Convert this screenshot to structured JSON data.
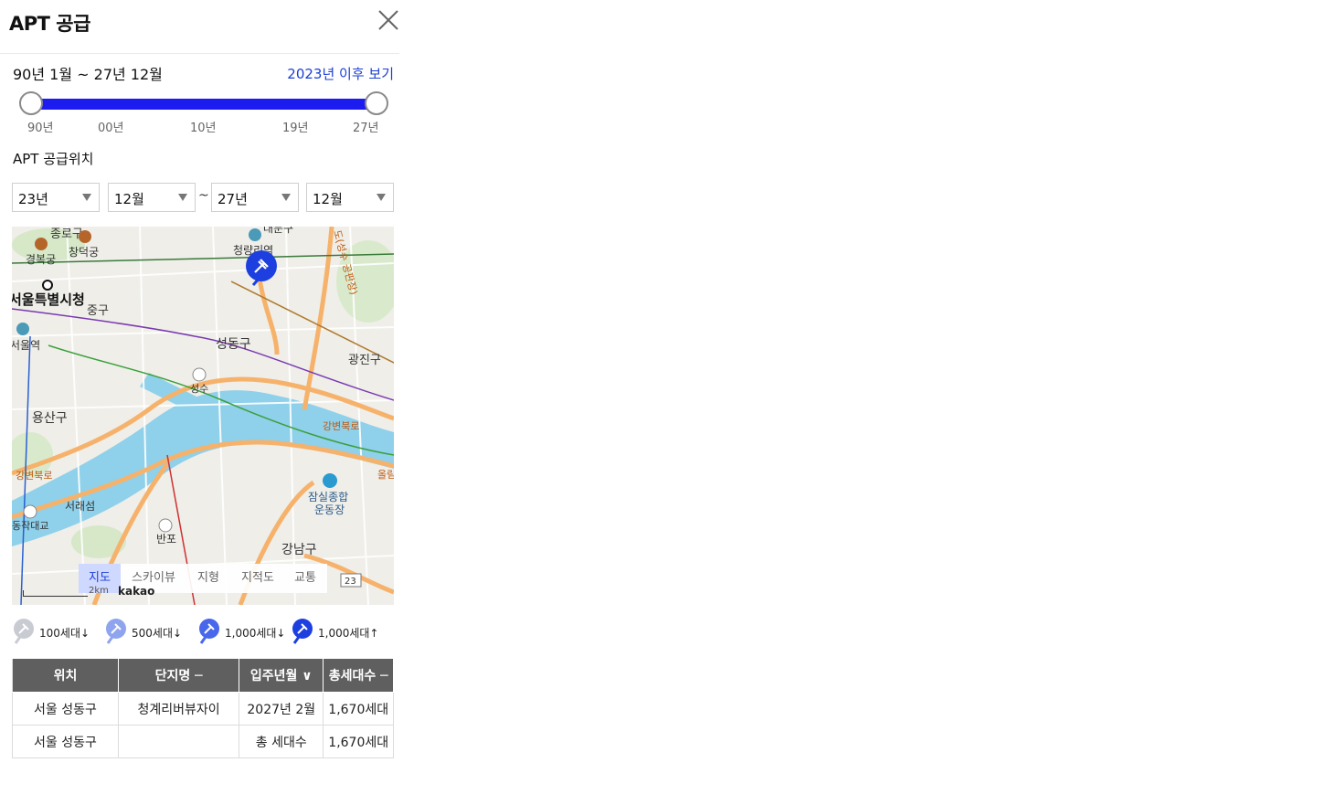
{
  "header": {
    "title": "APT 공급"
  },
  "period": {
    "label": "90년 1월 ~ 27년 12월",
    "since_link": "2023년 이후 보기"
  },
  "slider": {
    "start_fraction": 0.0,
    "end_fraction": 1.0,
    "ticks": [
      "90년",
      "00년",
      "10년",
      "19년",
      "27년"
    ]
  },
  "location": {
    "title": "APT 공급위치"
  },
  "filters": {
    "from_year": "23년",
    "from_month": "12월",
    "separator": "~",
    "to_year": "27년",
    "to_month": "12월"
  },
  "map": {
    "labels": {
      "jongno": "종로구",
      "changdeok": "창덕궁",
      "gyeongbok": "경복궁",
      "cityhall": "서울특별시청",
      "junggu": "중구",
      "seoul_station": "서울역",
      "seongdong": "성동구",
      "gwangjin": "광진구",
      "seongsu": "성수",
      "yongsan": "용산구",
      "gangbyeon1": "강변북로",
      "gangbyeon2": "강변북로",
      "seoraeseom": "서래섬",
      "dongjak": "동작대교",
      "banpo": "반포",
      "gangnam": "강남구",
      "jamsil": "잠실종합",
      "jamsil2": "운동장",
      "cheongnyangni": "청량리역",
      "dongdaemun": "대문구",
      "inner_ring": "도(성수 공판장)",
      "olympic": "올림",
      "route": "23"
    },
    "tabs": [
      "지도",
      "스카이뷰",
      "지형",
      "지적도",
      "교통"
    ],
    "active_tab": "지도",
    "scale": "2km",
    "brand": "kakao",
    "colors": {
      "marker": "#1d3fe0",
      "river": "#7cc8e6",
      "road_major": "#f6b26b"
    }
  },
  "legend": [
    {
      "label": "100세대↓",
      "color": "#c9cbd3"
    },
    {
      "label": "500세대↓",
      "color": "#8fa4ee"
    },
    {
      "label": "1,000세대↓",
      "color": "#4967ea"
    },
    {
      "label": "1,000세대↑",
      "color": "#1d3fe0"
    }
  ],
  "table": {
    "headers": [
      "위치",
      "단지명 ─",
      "입주년월 ∨",
      "총세대수 ─"
    ],
    "rows": [
      [
        "서울 성동구",
        "청계리버뷰자이",
        "2027년 2월",
        "1,670세대"
      ],
      [
        "서울 성동구",
        "",
        "총 세대수",
        "1,670세대"
      ]
    ]
  }
}
